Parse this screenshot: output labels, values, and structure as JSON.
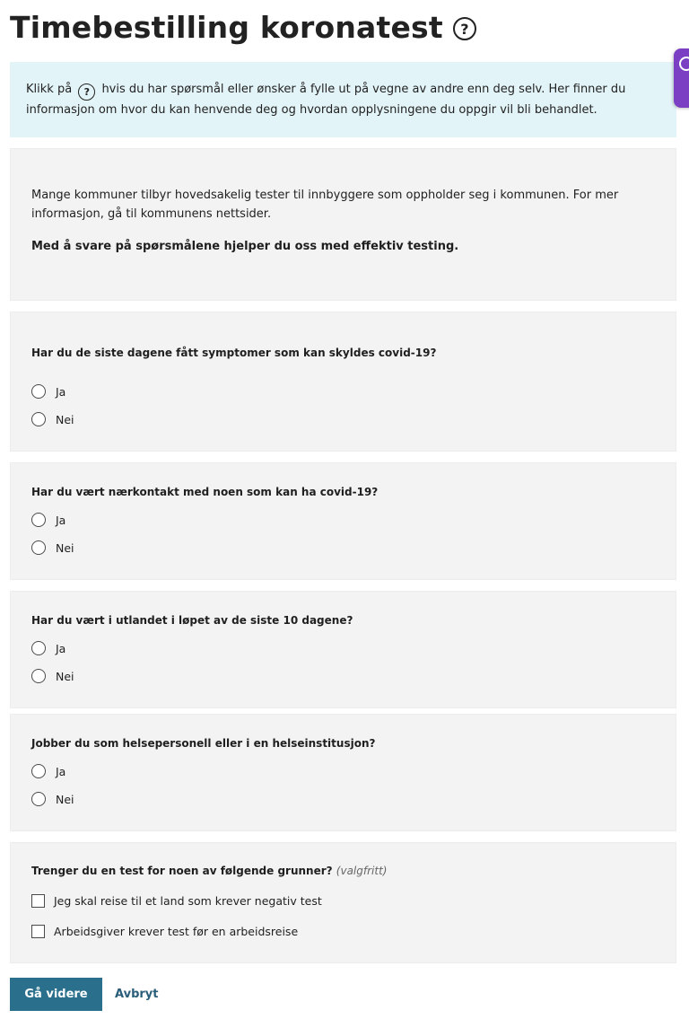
{
  "header": {
    "title": "Timebestilling koronatest",
    "help_glyph": "?"
  },
  "info": {
    "prefix": "Klikk på",
    "help_glyph": "?",
    "text": "hvis du har spørsmål eller ønsker å fylle ut på vegne av andre enn deg selv. Her finner du informasjon om hvor du kan henvende deg og hvordan opplysningene du oppgir vil bli behandlet."
  },
  "intro": {
    "text": "Mange kommuner tilbyr hovedsakelig tester til innbyggere som oppholder seg i kommunen. For mer informasjon, gå til kommunens nettsider.",
    "bold_text": "Med å svare på spørsmålene hjelper du oss med effektiv testing."
  },
  "questions": [
    {
      "label": "Har du de siste dagene fått symptomer som kan skyldes covid-19?",
      "options": [
        "Ja",
        "Nei"
      ]
    },
    {
      "label": "Har du vært nærkontakt med noen som kan ha covid-19?",
      "options": [
        "Ja",
        "Nei"
      ]
    },
    {
      "label": "Har du vært i utlandet i løpet av de siste 10 dagene?",
      "options": [
        "Ja",
        "Nei"
      ]
    },
    {
      "label": "Jobber du som helsepersonell eller i en helseinstitusjon?",
      "options": [
        "Ja",
        "Nei"
      ]
    }
  ],
  "reasons": {
    "label": "Trenger du en test for noen av følgende grunner?",
    "optional": "(valgfritt)",
    "options": [
      "Jeg skal reise til et land som krever negativ test",
      "Arbeidsgiver krever test før en arbeidsreise"
    ]
  },
  "actions": {
    "next_label": "Gå videre",
    "cancel_label": "Avbryt"
  },
  "colors": {
    "primary_button": "#2a6f8b",
    "info_background": "#e3f4f8",
    "card_background": "#f4f3f3",
    "side_tab": "#7b3fc4"
  }
}
